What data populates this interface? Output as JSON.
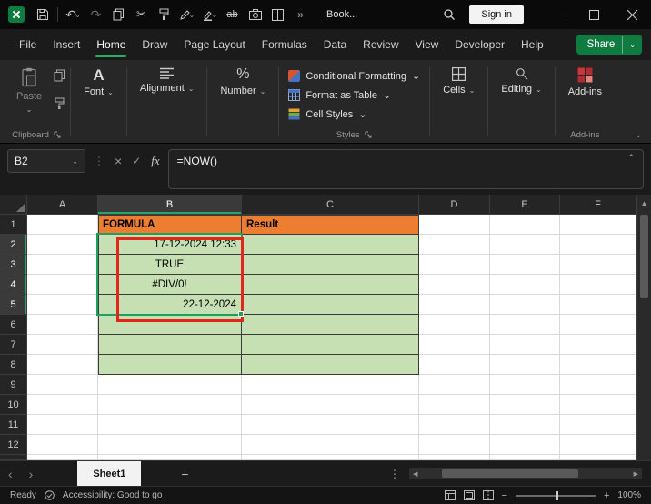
{
  "colors": {
    "accent_green": "#2bac62",
    "share_green": "#0f7b41",
    "orange_fill": "#ED7D31",
    "green_fill": "#C6E0B4",
    "annotation_red": "#E3261A",
    "selection_green": "#1FA05C"
  },
  "titlebar": {
    "workbook_name": "Book...",
    "sign_in_label": "Sign in"
  },
  "menubar": {
    "items": [
      "File",
      "Insert",
      "Home",
      "Draw",
      "Page Layout",
      "Formulas",
      "Data",
      "Review",
      "View",
      "Developer",
      "Help"
    ],
    "active_item": "Home",
    "share_label": "Share"
  },
  "ribbon": {
    "paste_label": "Paste",
    "clipboard_group_label": "Clipboard",
    "font_label": "Font",
    "alignment_label": "Alignment",
    "number_label": "Number",
    "conditional_formatting_label": "Conditional Formatting",
    "format_as_table_label": "Format as Table",
    "cell_styles_label": "Cell Styles",
    "styles_group_label": "Styles",
    "cells_label": "Cells",
    "editing_label": "Editing",
    "addins_label": "Add-ins",
    "addins_group_label": "Add-ins"
  },
  "formula_bar": {
    "name_box_value": "B2",
    "fx_label": "fx",
    "formula": "=NOW()"
  },
  "grid": {
    "columns": [
      "A",
      "B",
      "C",
      "D",
      "E",
      "F"
    ],
    "rows": [
      "1",
      "2",
      "3",
      "4",
      "5",
      "6",
      "7",
      "8",
      "9",
      "10",
      "11",
      "12"
    ],
    "cells": [
      {
        "ref": "B1",
        "text": "FORMULA",
        "fill": "orange",
        "bold": true,
        "align": "left"
      },
      {
        "ref": "C1",
        "text": "Result",
        "fill": "orange",
        "bold": true,
        "align": "left"
      },
      {
        "ref": "B2",
        "text": "17-12-2024 12:33",
        "fill": "green",
        "align": "right"
      },
      {
        "ref": "B3",
        "text": "TRUE",
        "fill": "green",
        "align": "center"
      },
      {
        "ref": "B4",
        "text": "#DIV/0!",
        "fill": "green",
        "align": "center"
      },
      {
        "ref": "B5",
        "text": "22-12-2024",
        "fill": "green",
        "align": "right"
      }
    ],
    "green_range": {
      "col_start": "B",
      "col_end": "C",
      "row_start": 2,
      "row_end": 8
    },
    "bordered_range": {
      "col_start": "B",
      "col_end": "C",
      "row_start": 1,
      "row_end": 8
    },
    "selection": {
      "range": "B2:B5",
      "active_cell": "B2",
      "selected_columns": [
        "B"
      ],
      "selected_rows": [
        2,
        3,
        4,
        5
      ]
    },
    "annotation": {
      "type": "red-box",
      "range": "B2:B5"
    }
  },
  "sheet_tabs": {
    "tabs": [
      {
        "label": "Sheet1",
        "active": true
      }
    ],
    "add_label": "+"
  },
  "status_bar": {
    "mode": "Ready",
    "accessibility_text": "Accessibility: Good to go",
    "zoom_level": "100%"
  }
}
